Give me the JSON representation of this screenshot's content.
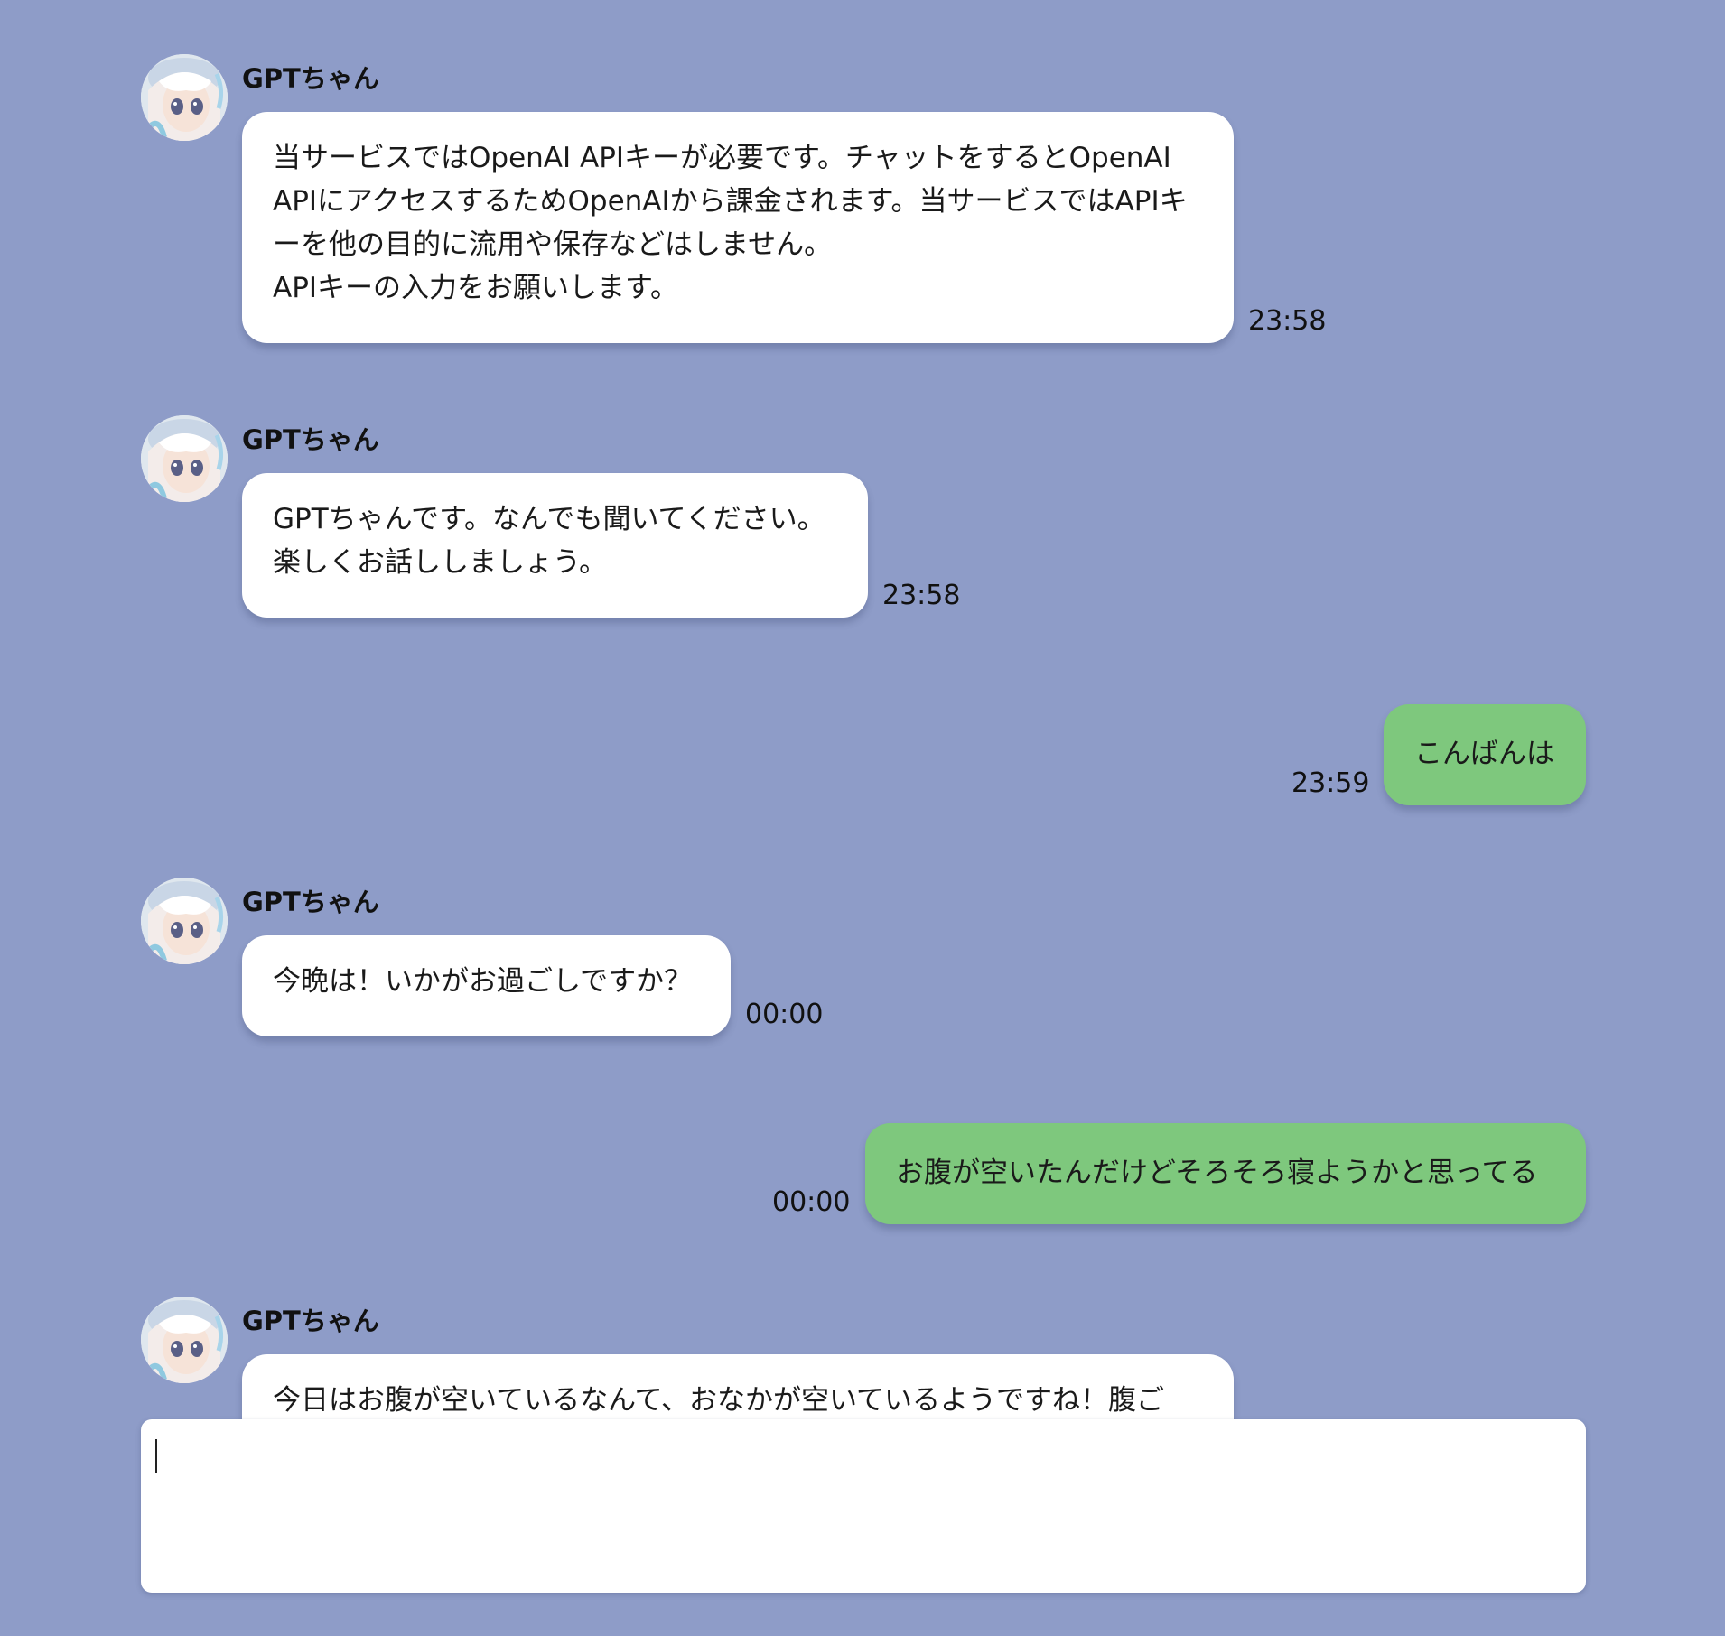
{
  "bot_name": "GPTちゃん",
  "messages": [
    {
      "role": "bot",
      "sender": "GPTちゃん",
      "text": "当サービスではOpenAI APIキーが必要です。チャットをするとOpenAI\nAPIにアクセスするためOpenAIから課金されます。当サービスではAPIキ\nーを他の目的に流用や保存などはしません。\nAPIキーの入力をお願いします。",
      "time": "23:58"
    },
    {
      "role": "bot",
      "sender": "GPTちゃん",
      "text": "GPTちゃんです。なんでも聞いてください。\n楽しくお話ししましょう。",
      "time": "23:58"
    },
    {
      "role": "user",
      "text": "こんばんは",
      "time": "23:59"
    },
    {
      "role": "bot",
      "sender": "GPTちゃん",
      "text": "今晩は！いかがお過ごしですか？",
      "time": "00:00"
    },
    {
      "role": "user",
      "text": "お腹が空いたんだけどそろそろ寝ようかと思ってる",
      "time": "00:00"
    },
    {
      "role": "bot",
      "sender": "GPTちゃん",
      "text": "今日はお腹が空いているなんて、おなかが空いているようですね！腹ご",
      "time": ""
    }
  ],
  "composer": {
    "value": "",
    "placeholder": ""
  },
  "colors": {
    "background": "#8e9cc8",
    "bot_bubble": "#ffffff",
    "user_bubble": "#7ec87d"
  },
  "icons": {
    "avatar": "anime-girl-avatar-icon"
  }
}
